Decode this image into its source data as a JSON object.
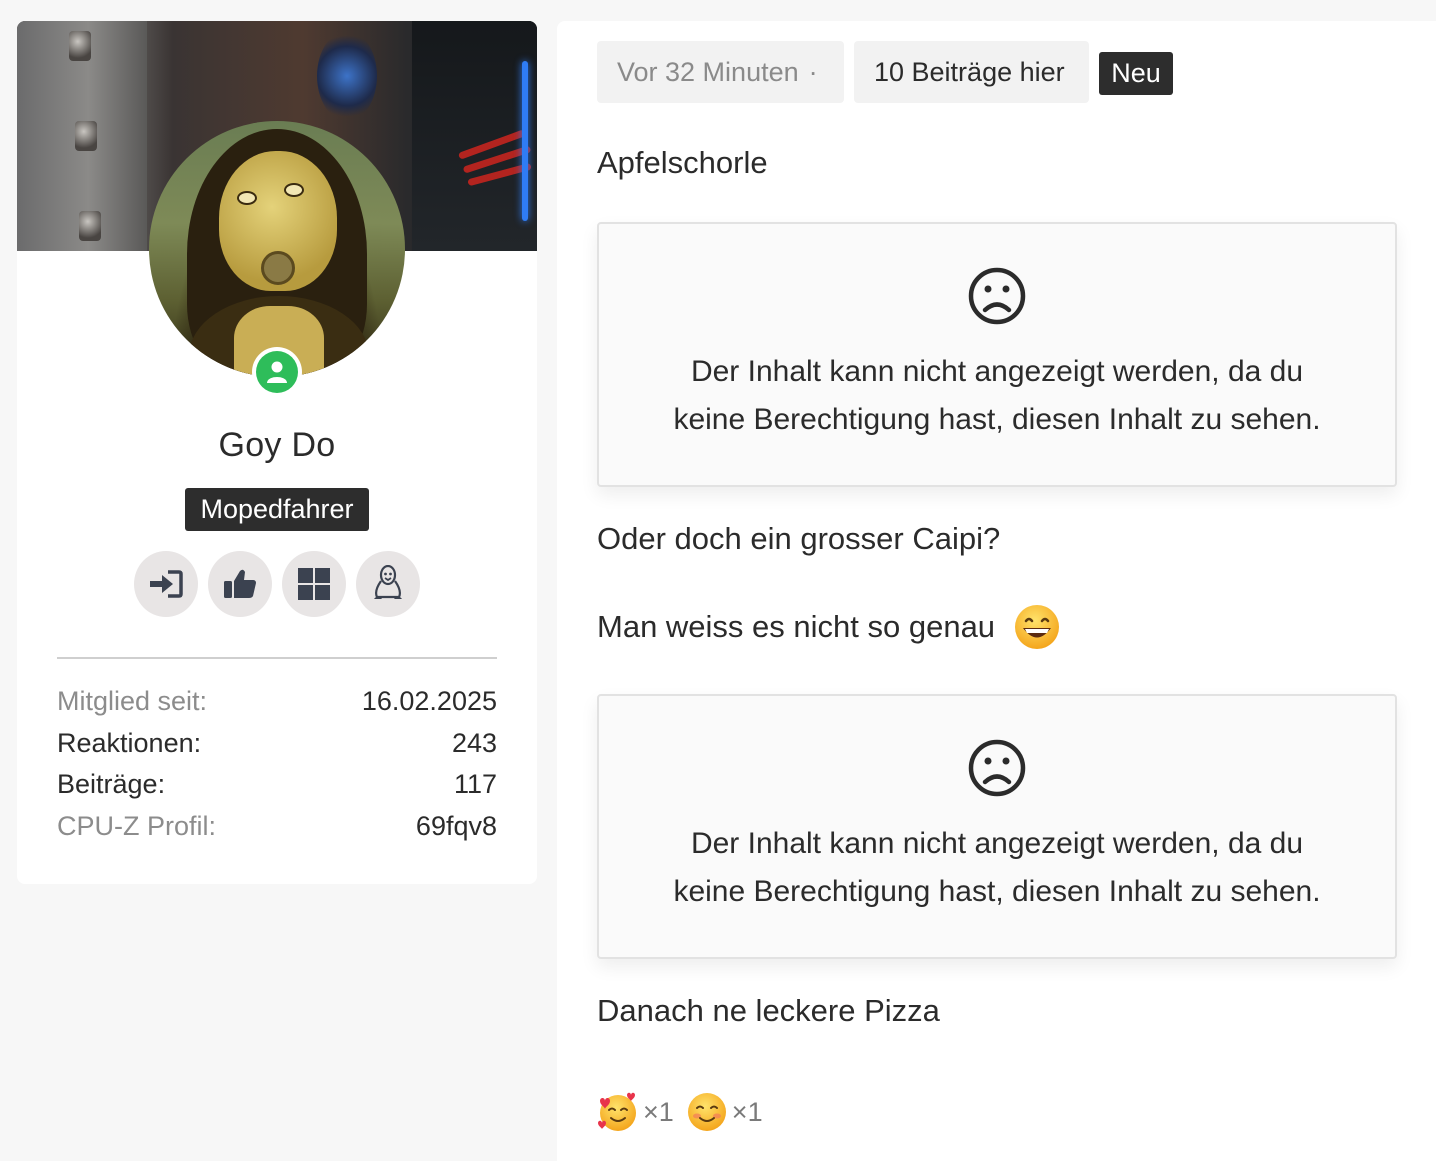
{
  "profile": {
    "name": "Goy Do",
    "title": "Mopedfahrer",
    "badges": [
      {
        "icon": "sign-in-icon"
      },
      {
        "icon": "thumbs-up-icon"
      },
      {
        "icon": "windows-icon"
      },
      {
        "icon": "linux-tux-icon"
      }
    ],
    "stats": [
      {
        "label": "Mitglied seit:",
        "value": "16.02.2025"
      },
      {
        "label": "Reaktionen:",
        "value": "243"
      },
      {
        "label": "Beiträge:",
        "value": "117"
      },
      {
        "label": "CPU-Z Profil:",
        "value": "69fqv8"
      }
    ],
    "online_color": "#2ebd5a"
  },
  "post": {
    "time": "Vor 32 Minuten",
    "separator": "·",
    "count": "10 Beiträge hier",
    "new_label": "Neu",
    "lines": {
      "l1": "Apfelschorle",
      "l2": "Oder doch ein grosser Caipi?",
      "l3": "Man weiss es nicht so genau",
      "l4": "Danach ne leckere Pizza"
    },
    "blocked_message": {
      "line1": "Der Inhalt kann nicht angezeigt werden, da du",
      "line2": "keine Berechtigung hast, diesen Inhalt zu sehen."
    },
    "inline_emoji": "grinning-face-icon",
    "reactions": [
      {
        "icon": "smiling-face-with-hearts-icon",
        "count": "×1"
      },
      {
        "icon": "smiling-face-icon",
        "count": "×1"
      }
    ]
  }
}
